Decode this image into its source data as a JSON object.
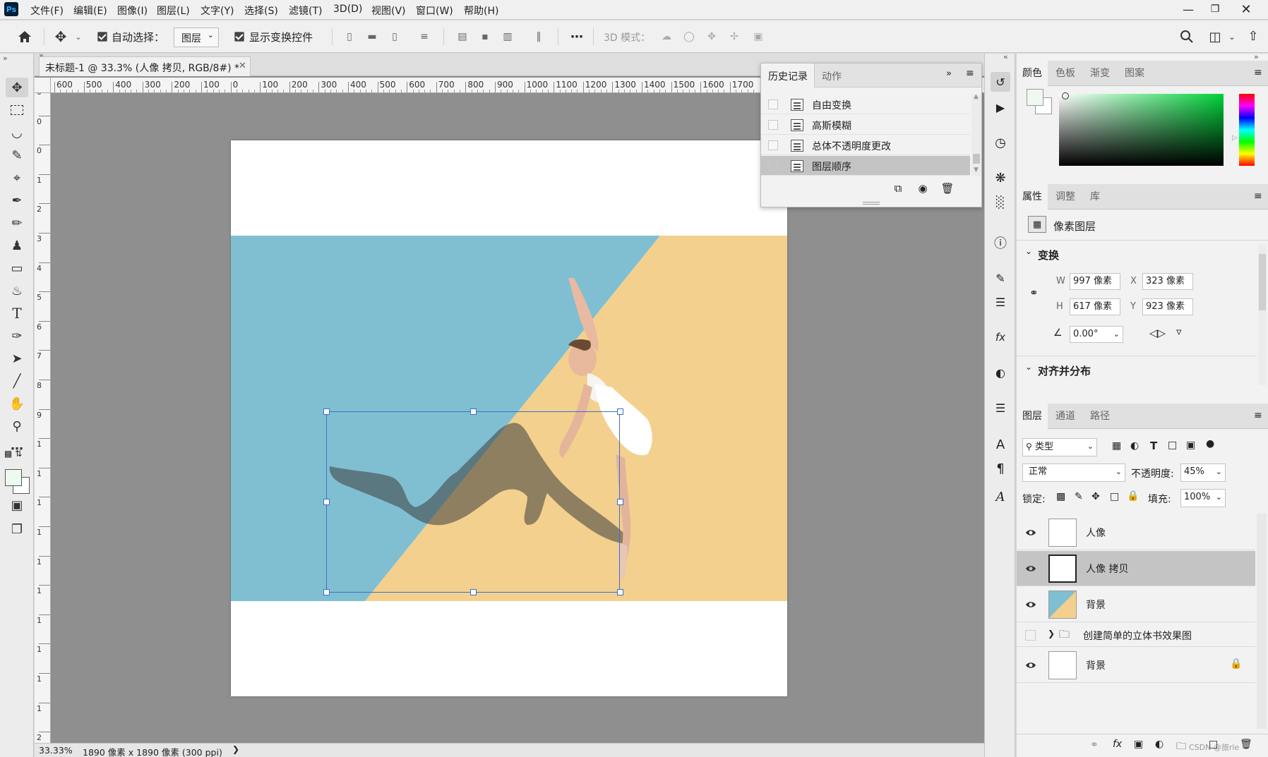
{
  "menubar": {
    "logo": "Ps",
    "items": [
      "文件(F)",
      "编辑(E)",
      "图像(I)",
      "图层(L)",
      "文字(Y)",
      "选择(S)",
      "滤镜(T)",
      "3D(D)",
      "视图(V)",
      "窗口(W)",
      "帮助(H)"
    ],
    "window_controls": [
      "minimize",
      "restore",
      "close"
    ]
  },
  "options_bar": {
    "auto_select_label": "自动选择：",
    "auto_select_value": "图层",
    "show_transform_label": "显示变换控件",
    "mode_3d_label": "3D 模式："
  },
  "document": {
    "tab_title": "未标题-1 @ 33.3% (人像 拷贝, RGB/8#) *",
    "ruler_top": [
      "600",
      "500",
      "400",
      "300",
      "200",
      "100",
      "0",
      "100",
      "200",
      "300",
      "400",
      "500",
      "600",
      "700",
      "800",
      "900",
      "1000",
      "1100",
      "1200",
      "1300",
      "1400",
      "1500",
      "1600",
      "1700"
    ],
    "ruler_left": [
      "0",
      "0",
      "0",
      "1",
      "2",
      "3",
      "4",
      "5",
      "6",
      "7",
      "8",
      "9",
      "1",
      "1",
      "1",
      "1",
      "1",
      "1",
      "1",
      "1",
      "1",
      "1",
      "2"
    ]
  },
  "status": {
    "zoom": "33.33%",
    "doc_info": "1890 像素 x 1890 像素 (300 ppi)"
  },
  "history_panel": {
    "tabs": [
      "历史记录",
      "动作"
    ],
    "items": [
      "自由变换",
      "高斯模糊",
      "总体不透明度更改",
      "图层顺序"
    ],
    "selected_index": 3
  },
  "color_panel": {
    "tabs": [
      "颜色",
      "色板",
      "渐变",
      "图案"
    ],
    "hue_color": "#00d23a"
  },
  "properties_panel": {
    "tabs": [
      "属性",
      "调整",
      "库"
    ],
    "type_label": "像素图层",
    "transform_header": "变换",
    "w_label": "W",
    "w_value": "997 像素",
    "h_label": "H",
    "h_value": "617 像素",
    "x_label": "X",
    "x_value": "323 像素",
    "y_label": "Y",
    "y_value": "923 像素",
    "angle_value": "0.00°",
    "align_header": "对齐并分布"
  },
  "layers_panel": {
    "tabs": [
      "图层",
      "通道",
      "路径"
    ],
    "filter_label": "类型",
    "blend_mode": "正常",
    "opacity_label": "不透明度:",
    "opacity_value": "45%",
    "lock_label": "锁定:",
    "fill_label": "填充:",
    "fill_value": "100%",
    "layers": [
      {
        "name": "人像",
        "visible": true,
        "selected": false
      },
      {
        "name": "人像 拷贝",
        "visible": true,
        "selected": true
      },
      {
        "name": "背景",
        "visible": true,
        "selected": false
      },
      {
        "name": "创建简单的立体书效果图",
        "visible": false,
        "selected": false,
        "group": true
      },
      {
        "name": "背景",
        "visible": true,
        "selected": false,
        "locked": true
      }
    ],
    "watermark": "CSDN @旅rle"
  }
}
